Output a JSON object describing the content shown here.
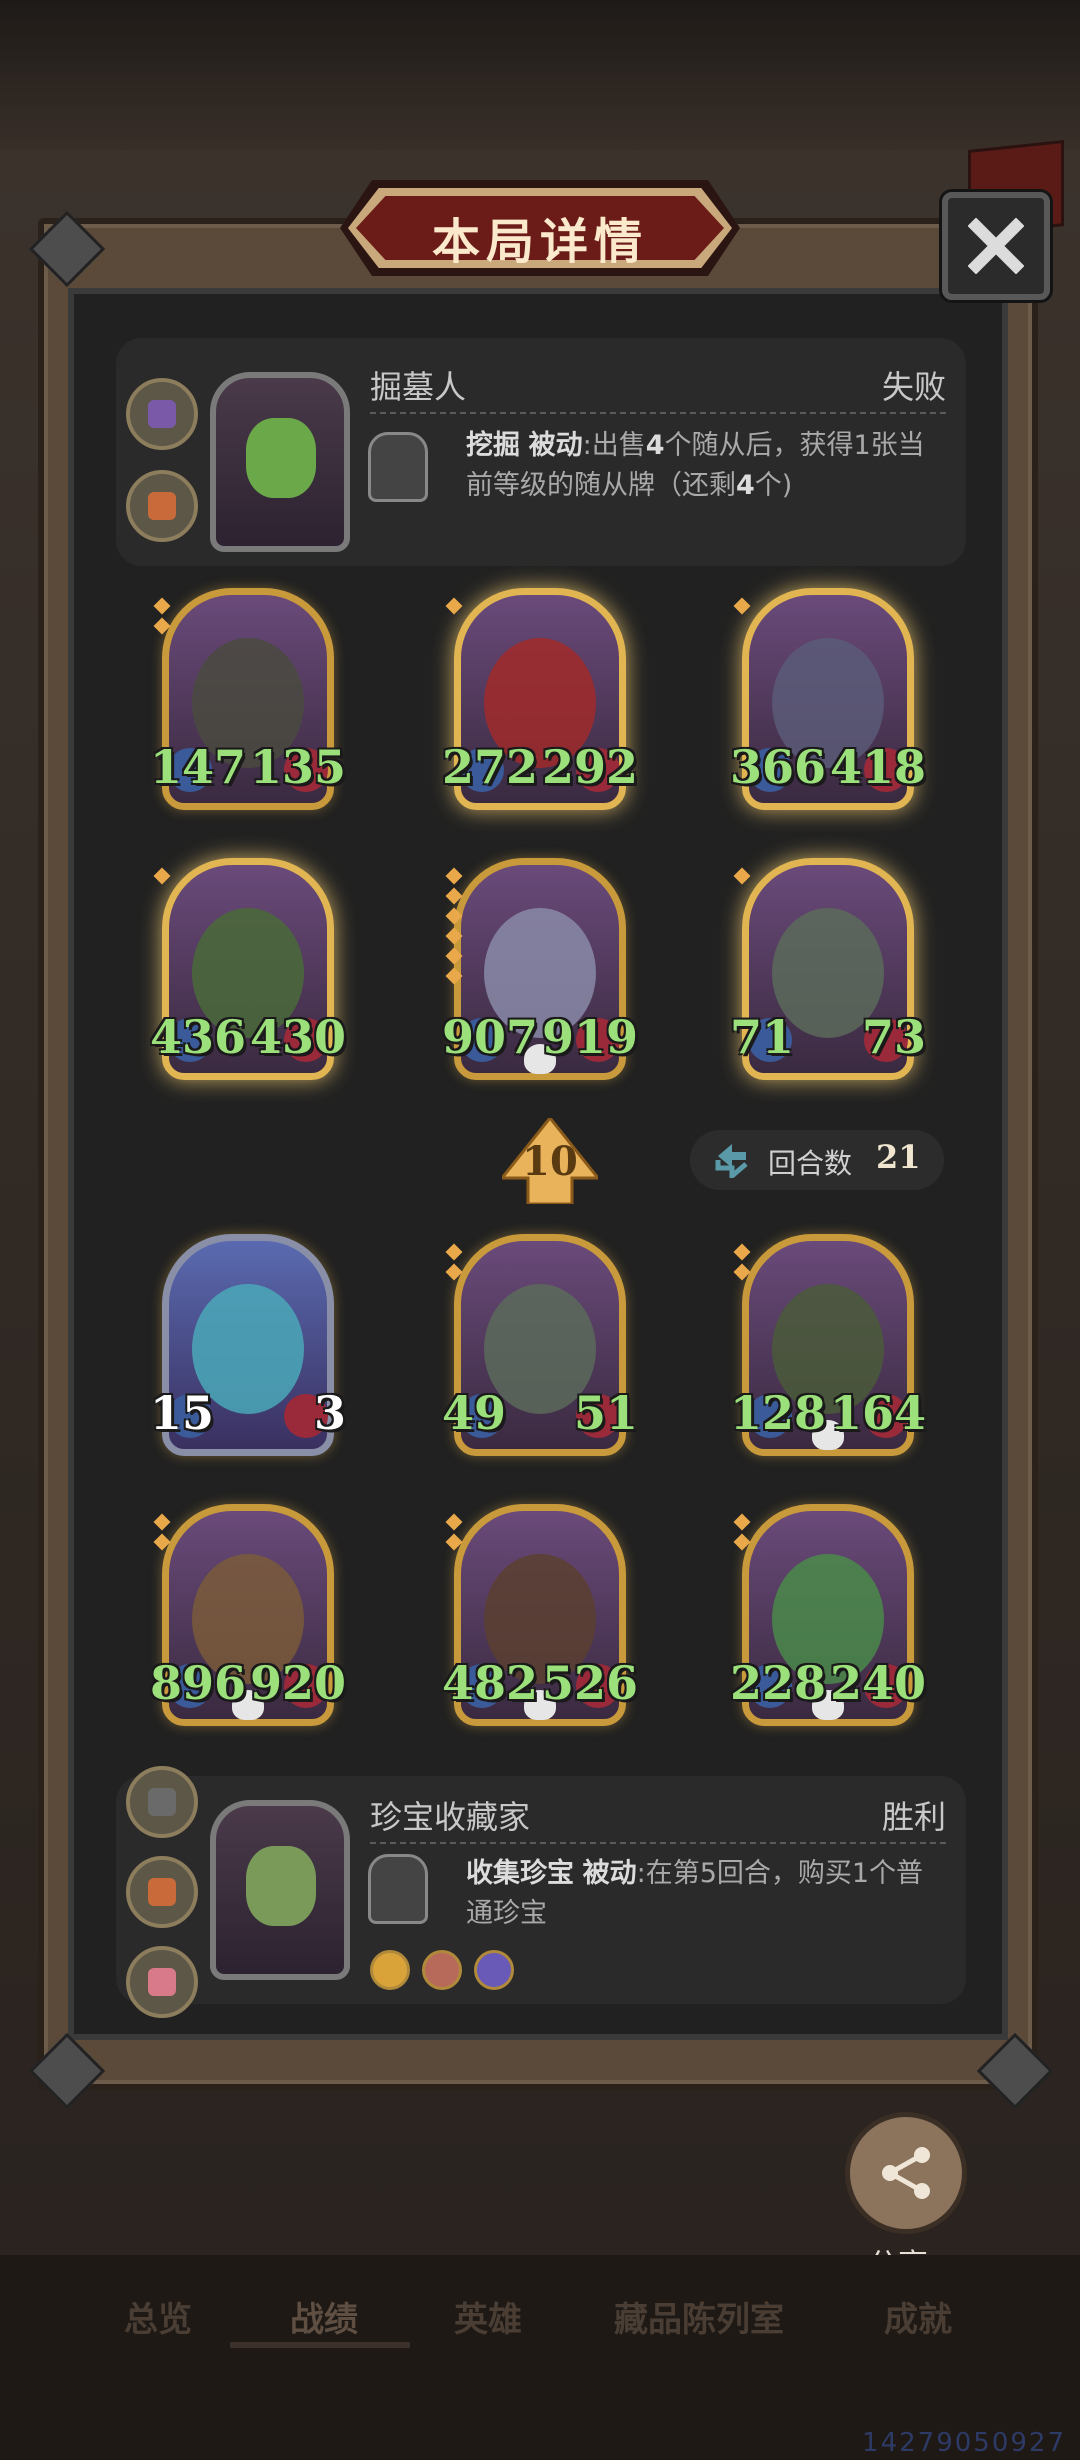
{
  "header": {
    "title": "本局详情"
  },
  "opponent": {
    "name": "掘墓人",
    "result": "失败",
    "skill": {
      "name": "挖掘",
      "type": "被动",
      "text_pre": ":出售",
      "highlight_1": "4",
      "text_mid": "个随从后，获得1张当前等级的随从牌（还剩",
      "highlight_2": "4",
      "text_post": "个)"
    }
  },
  "opponent_board": [
    {
      "attack": "147",
      "health": "135",
      "stars": 2,
      "golden": false,
      "skull": false,
      "art": "#4a4a40"
    },
    {
      "attack": "272",
      "health": "292",
      "stars": 1,
      "golden": true,
      "skull": false,
      "art": "#a02a2a"
    },
    {
      "attack": "366",
      "health": "418",
      "stars": 1,
      "golden": true,
      "skull": false,
      "art": "#5a5a78"
    },
    {
      "attack": "436",
      "health": "430",
      "stars": 1,
      "golden": true,
      "skull": false,
      "art": "#4a6a3a"
    },
    {
      "attack": "907",
      "health": "919",
      "stars": 6,
      "golden": false,
      "skull": true,
      "art": "#8a8aa8"
    },
    {
      "attack": "71",
      "health": "73",
      "stars": 1,
      "golden": true,
      "skull": false,
      "art": "#5a6a5a"
    }
  ],
  "tier": "10",
  "round": {
    "label": "回合数",
    "value": "21"
  },
  "player_board": [
    {
      "attack": "15",
      "health": "3",
      "stars": 0,
      "golden": false,
      "silver": true,
      "skull": false,
      "art": "#4aa8b8"
    },
    {
      "attack": "49",
      "health": "51",
      "stars": 2,
      "golden": false,
      "skull": false,
      "art": "#5a6a5a"
    },
    {
      "attack": "128",
      "health": "164",
      "stars": 2,
      "golden": false,
      "skull": true,
      "art": "#4a5a3a"
    },
    {
      "attack": "896",
      "health": "920",
      "stars": 2,
      "golden": false,
      "skull": true,
      "art": "#7a5a3a"
    },
    {
      "attack": "482",
      "health": "526",
      "stars": 2,
      "golden": false,
      "skull": true,
      "art": "#5a4030"
    },
    {
      "attack": "228",
      "health": "240",
      "stars": 2,
      "golden": false,
      "skull": true,
      "art": "#4a8a4a"
    }
  ],
  "player": {
    "name": "珍宝收藏家",
    "result": "胜利",
    "skill": {
      "name": "收集珍宝",
      "type": "被动",
      "text_pre": ":在第5回合，购买1个普通珍宝"
    }
  },
  "share": {
    "label": "分享"
  },
  "tabs": [
    "总览",
    "战绩",
    "英雄",
    "藏品陈列室",
    "成就"
  ],
  "uid": "14279050927"
}
